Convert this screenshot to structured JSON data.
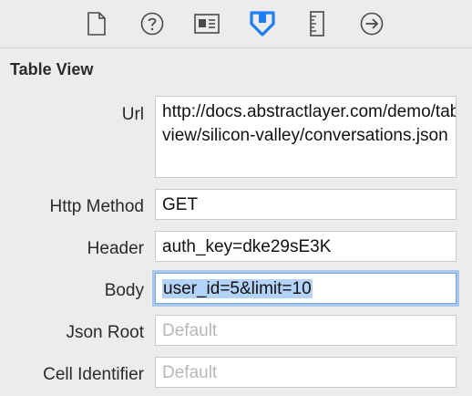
{
  "toolbar": {
    "icons": [
      "file-icon",
      "help-icon",
      "identity-icon",
      "attributes-icon",
      "size-icon",
      "connections-icon"
    ],
    "active": "attributes-icon",
    "active_color": "#1f7ef0"
  },
  "section": {
    "title": "Table View"
  },
  "fields": [
    {
      "label": "Url",
      "value": "http://docs.abstractlayer.com/demo/table-view/silicon-valley/conversations.json",
      "placeholder": ""
    },
    {
      "label": "Http Method",
      "value": "GET",
      "placeholder": ""
    },
    {
      "label": "Header",
      "value": "auth_key=dke29sE3K",
      "placeholder": ""
    },
    {
      "label": "Body",
      "value": "user_id=5&limit=10",
      "placeholder": ""
    },
    {
      "label": "Json Root",
      "value": "",
      "placeholder": "Default"
    },
    {
      "label": "Cell Identifier",
      "value": "",
      "placeholder": "Default"
    }
  ]
}
